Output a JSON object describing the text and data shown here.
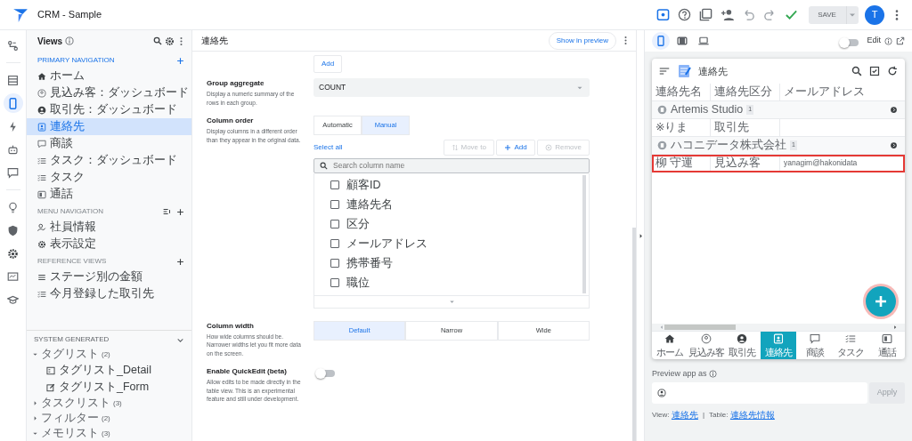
{
  "app": {
    "title": "CRM - Sample",
    "save": "SAVE",
    "avatar": "T"
  },
  "rail": [
    {
      "selected": false
    },
    {
      "selected": false
    },
    {
      "selected": true
    },
    {
      "selected": false
    },
    {
      "selected": false
    },
    {
      "selected": false
    },
    {
      "selected": false
    },
    {
      "selected": false
    },
    {
      "selected": false
    },
    {
      "selected": false
    },
    {
      "selected": false
    }
  ],
  "views": {
    "title": "Views",
    "sections": [
      {
        "heading": "PRIMARY NAVIGATION",
        "items": [
          {
            "label": "ホーム",
            "selected": false
          },
          {
            "label": "見込み客：ダッシュボード",
            "selected": false
          },
          {
            "label": "取引先：ダッシュボード",
            "selected": false
          },
          {
            "label": "連絡先",
            "selected": true
          },
          {
            "label": "商談",
            "selected": false
          },
          {
            "label": "タスク：ダッシュボード",
            "selected": false
          },
          {
            "label": "タスク",
            "selected": false
          },
          {
            "label": "通話",
            "selected": false
          }
        ]
      },
      {
        "heading": "MENU NAVIGATION",
        "items": [
          {
            "label": "社員情報",
            "selected": false
          },
          {
            "label": "表示設定",
            "selected": false
          }
        ]
      },
      {
        "heading": "REFERENCE VIEWS",
        "items": [
          {
            "label": "ステージ別の金額",
            "selected": false
          },
          {
            "label": "今月登録した取引先",
            "selected": false
          }
        ]
      }
    ],
    "system": {
      "heading": "SYSTEM GENERATED",
      "groups": [
        {
          "label": "タグリスト",
          "count": "(2)",
          "expanded": true,
          "children": [
            {
              "label": "タグリスト_Detail"
            },
            {
              "label": "タグリスト_Form"
            }
          ]
        },
        {
          "label": "タスクリスト",
          "count": "(3)",
          "expanded": false
        },
        {
          "label": "フィルター",
          "count": "(2)",
          "expanded": false
        },
        {
          "label": "メモリスト",
          "count": "(3)",
          "expanded": true
        }
      ]
    }
  },
  "editor": {
    "title": "連絡先",
    "preview_button": "Show in preview",
    "add_button": "Add",
    "group_aggregate": {
      "label": "Group aggregate",
      "description": "Display a numeric summary of the rows in each group.",
      "value": "COUNT"
    },
    "column_order": {
      "label": "Column order",
      "description": "Display columns in a different order than they appear in the original data.",
      "modes": [
        {
          "label": "Automatic",
          "selected": false
        },
        {
          "label": "Manual",
          "selected": true
        }
      ],
      "select_all": "Select all",
      "actions": [
        {
          "label": "Move to",
          "disabled": true
        },
        {
          "label": "Add",
          "disabled": false
        },
        {
          "label": "Remove",
          "disabled": true
        }
      ],
      "search": {
        "placeholder": "Search column name"
      },
      "columns": [
        {
          "label": "顧客ID",
          "checked": false
        },
        {
          "label": "連絡先名",
          "checked": false
        },
        {
          "label": "区分",
          "checked": false
        },
        {
          "label": "メールアドレス",
          "checked": false
        },
        {
          "label": "携帯番号",
          "checked": false
        },
        {
          "label": "職位",
          "checked": false
        }
      ]
    },
    "column_width": {
      "label": "Column width",
      "description": "How wide columns should be. Narrower widths let you fit more data on the screen.",
      "options": [
        {
          "label": "Default",
          "selected": true
        },
        {
          "label": "Narrow",
          "selected": false
        },
        {
          "label": "Wide",
          "selected": false
        }
      ]
    },
    "quick_edit": {
      "label": "Enable QuickEdit (beta)",
      "description": "Allow edits to be made directly in the table view. This is an experimental feature and still under development.",
      "on": false
    }
  },
  "preview": {
    "devices": [
      {
        "selected": true
      },
      {
        "selected": false
      },
      {
        "selected": false
      }
    ],
    "edit_label": "Edit",
    "edit_on": false,
    "app_title": "連絡先",
    "columns": [
      "連絡先名",
      "連絡先区分",
      "メールアドレス"
    ],
    "rows": [
      {
        "kind": "group",
        "label": "Artemis Studio",
        "count": "1"
      },
      {
        "kind": "row",
        "cells": [
          "※りま",
          "取引先",
          ""
        ],
        "highlighted": false
      },
      {
        "kind": "group",
        "label": "ハコニデータ株式会社",
        "count": "1"
      },
      {
        "kind": "row",
        "cells": [
          "柳 守運",
          "見込み客",
          "yanagim@hakonidata"
        ],
        "highlighted": true
      }
    ],
    "nav": [
      {
        "label": "ホーム",
        "selected": false
      },
      {
        "label": "見込み客",
        "selected": false
      },
      {
        "label": "取引先",
        "selected": false
      },
      {
        "label": "連絡先",
        "selected": true
      },
      {
        "label": "商談",
        "selected": false
      },
      {
        "label": "タスク",
        "selected": false
      },
      {
        "label": "通話",
        "selected": false
      }
    ],
    "preview_as": {
      "label": "Preview app as",
      "button": "Apply"
    },
    "footer": {
      "view_label": "View:",
      "view": "連絡先",
      "separator": "|",
      "table_label": "Table:",
      "table": "連絡先情報"
    }
  }
}
